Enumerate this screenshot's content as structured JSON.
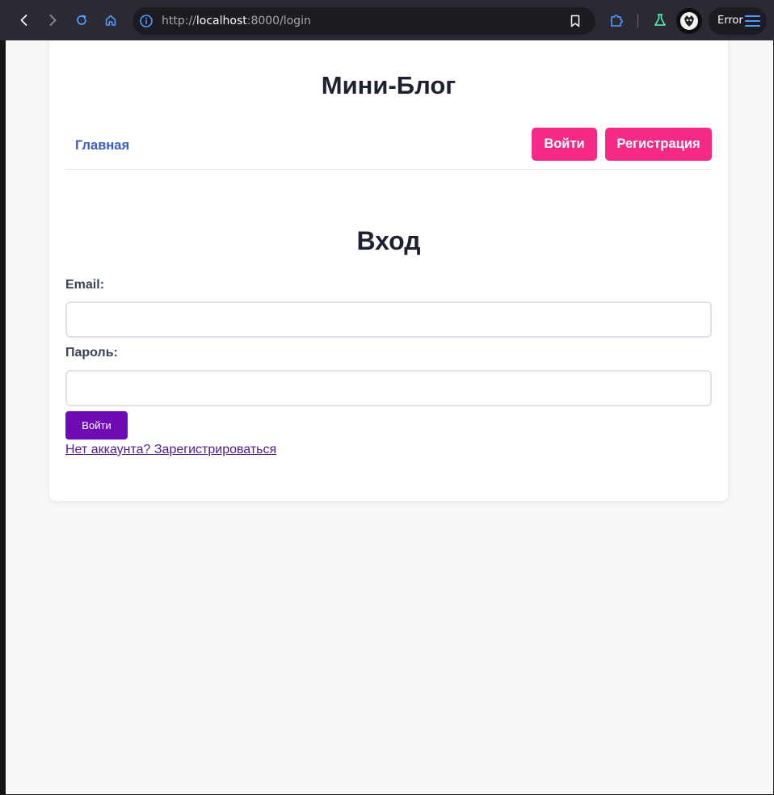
{
  "browser": {
    "url_prefix": "http://",
    "url_host": "localhost",
    "url_rest": ":8000/login",
    "status_label": "Error",
    "colors": {
      "toolbar": "#2b2a33",
      "urlbar": "#1c1b22",
      "accent": "#4f9cff"
    }
  },
  "site": {
    "title": "Мини-Блог",
    "nav": {
      "home_label": "Главная",
      "login_label": "Войти",
      "register_label": "Регистрация"
    },
    "colors": {
      "nav_button": "#f42a86",
      "submit": "#6e0bb5",
      "link": "#3e5bbf"
    }
  },
  "login": {
    "title": "Вход",
    "email_label": "Email:",
    "email_value": "",
    "password_label": "Пароль:",
    "password_value": "",
    "submit_label": "Войти",
    "register_link": "Нет аккаунта? Зарегистрироваться"
  }
}
